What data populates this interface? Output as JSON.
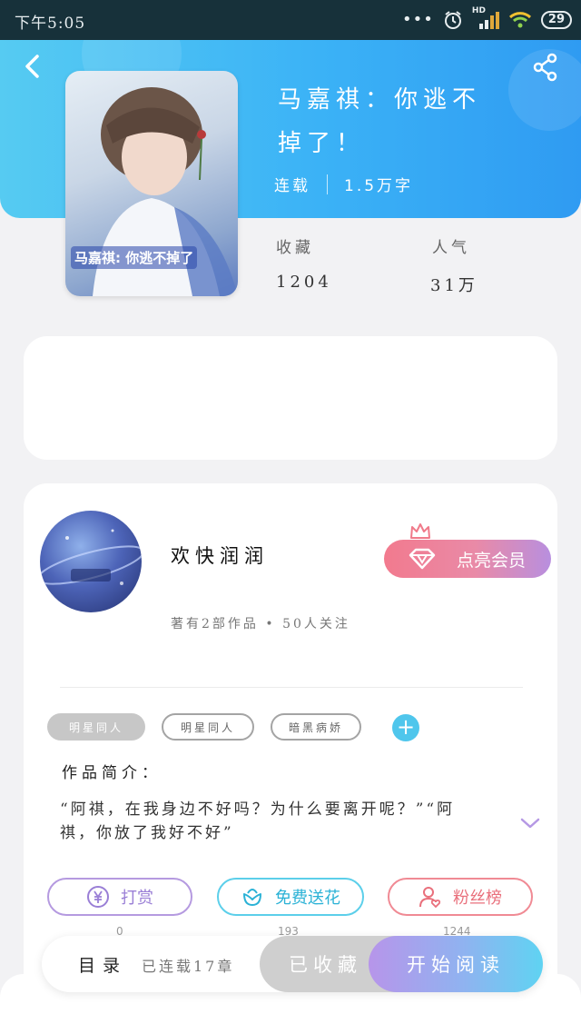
{
  "status_bar": {
    "time": "下午5:05",
    "signal_label": "HD",
    "battery": "29"
  },
  "header": {
    "colors": {
      "gradient_start": "#56cbf2",
      "gradient_end": "#2f9bf2"
    }
  },
  "book": {
    "cover_caption": "马嘉祺: 你逃不掉了",
    "title": "马嘉祺：你逃不掉了！",
    "status": "连载",
    "word_count": "1.5万字",
    "stats": [
      {
        "label": "收藏",
        "value": "1204"
      },
      {
        "label": "人气",
        "value": "31万"
      }
    ]
  },
  "author": {
    "name": "欢快润润",
    "stats": "著有2部作品 • 50人关注",
    "vip_button": "点亮会员"
  },
  "tags": [
    "明星同人",
    "明星同人",
    "暗黑病娇"
  ],
  "intro": {
    "heading": "作品简介：",
    "body": "“阿祺，在我身边不好吗？为什么要离开呢？”“阿祺，你放了我好不好”"
  },
  "actions": [
    {
      "label": "打赏",
      "icon": "yen-icon",
      "count": "0",
      "color": "#9a7fd6"
    },
    {
      "label": "免费送花",
      "icon": "flower-icon",
      "count": "193",
      "color": "#2bb2d6"
    },
    {
      "label": "粉丝榜",
      "icon": "user-heart-icon",
      "count": "1244",
      "color": "#e9707c"
    }
  ],
  "bottom_bar": {
    "toc": "目录",
    "serial": "已连载17章",
    "collected": "已收藏",
    "read": "开始阅读"
  }
}
